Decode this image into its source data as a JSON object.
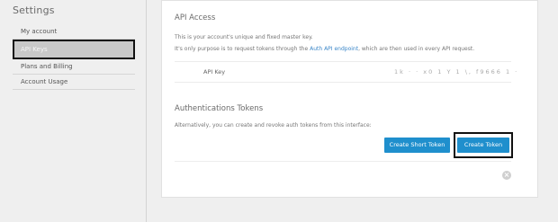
{
  "sidebar": {
    "title": "Settings",
    "items": [
      {
        "label": "My account"
      },
      {
        "label": "API Keys"
      },
      {
        "label": "Plans and Billing"
      },
      {
        "label": "Account Usage"
      }
    ]
  },
  "api_access": {
    "title": "API Access",
    "line1": "This is your account's unique and fixed master key.",
    "line2_before": "It's only purpose is to request tokens through the ",
    "line2_link": "Auth API endpoint",
    "line2_after": ", which are then used in every API request.",
    "key_label": "API Key",
    "key_value": "1k      ·   ·  x0  1  Y  1  \\,  f9666    1  ·"
  },
  "auth_tokens": {
    "title": "Authentications Tokens",
    "description": "Alternatively, you can create and revoke auth tokens from this interface:",
    "create_short_label": "Create Short Token",
    "create_label": "Create Token"
  },
  "colors": {
    "accent": "#1f8fcd",
    "background": "#efefef",
    "panel": "#ffffff"
  },
  "icons": {
    "close": "close-icon"
  }
}
